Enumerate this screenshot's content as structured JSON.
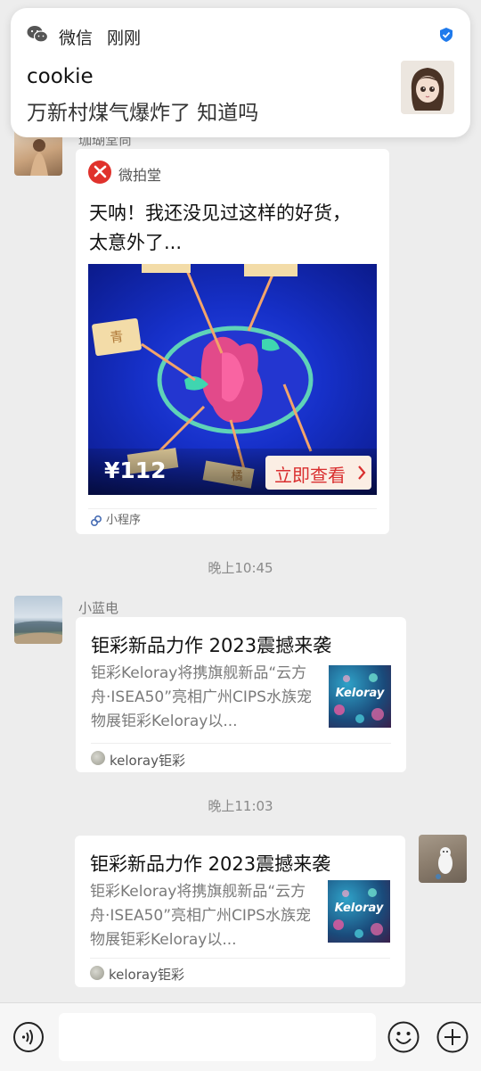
{
  "notification": {
    "app_name": "微信",
    "time": "刚刚",
    "sender": "cookie",
    "message": "万新村煤气爆炸了 知道吗"
  },
  "messages": [
    {
      "sender": "珈瑚堂尚",
      "type": "mini-program",
      "brand": "微拍堂",
      "title": "天呐！我还没见过这样的好货，太意外了...",
      "image_labels": [
        "青",
        "橘"
      ],
      "price": "¥112",
      "cta": "立即查看",
      "footer": "小程序"
    },
    {
      "type": "timestamp",
      "text": "晚上10:45"
    },
    {
      "sender": "小蓝电",
      "type": "link",
      "title": "钜彩新品力作 2023震撼来袭",
      "description": "钜彩Keloray将携旗舰新品“云方舟·ISEA50”亮相广州CIPS水族宠物展钜彩Keloray以...",
      "thumbnail_text": "Keloray",
      "source": "keloray钜彩"
    },
    {
      "type": "timestamp",
      "text": "晚上11:03"
    },
    {
      "sender": "me",
      "type": "link",
      "title": "钜彩新品力作 2023震撼来袭",
      "description": "钜彩Keloray将携旗舰新品“云方舟·ISEA50”亮相广州CIPS水族宠物展钜彩Keloray以...",
      "thumbnail_text": "Keloray",
      "source": "keloray钜彩"
    }
  ],
  "input_bar": {
    "voice_icon": "voice-icon",
    "emoji_icon": "emoji-icon",
    "plus_icon": "plus-icon"
  },
  "colors": {
    "background": "#ededed",
    "verified": "#1f7aec",
    "cta": "#d92f2f",
    "brand": "#e0322c"
  }
}
